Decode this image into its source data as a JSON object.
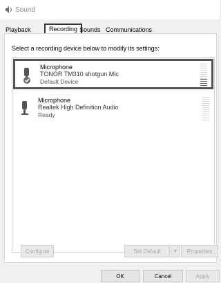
{
  "window": {
    "title": "Sound",
    "icon": "speaker-icon"
  },
  "tabs": [
    {
      "label": "Playback",
      "active": false
    },
    {
      "label": "Recording",
      "active": true
    },
    {
      "label": "Sounds",
      "active": false
    },
    {
      "label": "Communications",
      "active": false
    }
  ],
  "panel": {
    "instruction": "Select a recording device below to modify its settings:"
  },
  "devices": [
    {
      "name": "Microphone",
      "description": "TONOR TM310 shotgun Mic",
      "status": "Default Device",
      "icon": "microphone-icon",
      "badge": "check-badge-icon",
      "selected": true,
      "level": 0.35
    },
    {
      "name": "Microphone",
      "description": "Realtek High Definition Audio",
      "status": "Ready",
      "icon": "microphone-icon",
      "selected": false,
      "level": 0
    }
  ],
  "buttons": {
    "configure": "Configure",
    "set_default": "Set Default",
    "set_default_arrow": "▼",
    "properties": "Properties",
    "ok": "OK",
    "cancel": "Cancel",
    "apply": "Apply"
  },
  "colors": {
    "highlight_border": "#555555",
    "disabled_text": "#a7a7a7"
  }
}
